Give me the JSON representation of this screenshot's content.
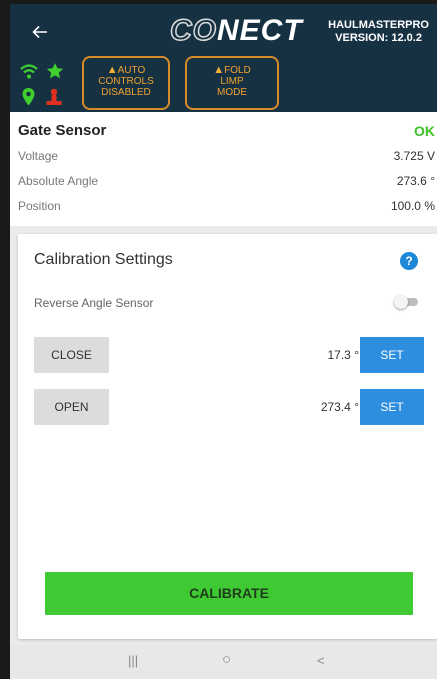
{
  "header": {
    "logo_prefix": "CO",
    "logo_suffix": "NECT",
    "version_line1": "HAULMASTERPRO",
    "version_line2": "VERSION: 12.0.2",
    "status_icons": [
      "wifi-icon",
      "star-icon",
      "location-pin-icon",
      "operator-icon"
    ],
    "icon_colors": {
      "wifi": "#3fd02e",
      "star": "#3fd02e",
      "pin": "#3fd02e",
      "operator": "#e03020"
    },
    "warnings": [
      {
        "lines": [
          "AUTO",
          "CONTROLS",
          "DISABLED"
        ]
      },
      {
        "lines": [
          "FOLD",
          "LIMP",
          "MODE"
        ]
      }
    ]
  },
  "sensor": {
    "title": "Gate Sensor",
    "status": "OK",
    "rows": [
      {
        "label": "Voltage",
        "value": "3.725 V"
      },
      {
        "label": "Absolute Angle",
        "value": "273.6 °"
      },
      {
        "label": "Position",
        "value": "100.0 %"
      }
    ]
  },
  "calibration": {
    "title": "Calibration Settings",
    "reverse_label": "Reverse Angle Sensor",
    "reverse_enabled": false,
    "close": {
      "label": "CLOSE",
      "angle": "17.3 °",
      "set_label": "SET"
    },
    "open": {
      "label": "OPEN",
      "angle": "273.4 °",
      "set_label": "SET"
    },
    "calibrate_label": "CALIBRATE"
  },
  "navbar": {
    "recents": "|||",
    "home": "○",
    "back": "<"
  },
  "colors": {
    "header_bg": "#163242",
    "warning_border": "#d98a2b",
    "ok_green": "#3fbf28",
    "set_blue": "#2d8ee0",
    "calibrate_green": "#3fca34"
  }
}
